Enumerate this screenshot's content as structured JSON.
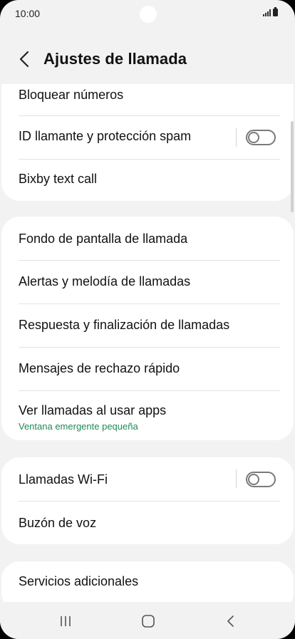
{
  "status": {
    "time": "10:00"
  },
  "header": {
    "title": "Ajustes de llamada"
  },
  "cards": {
    "block": {
      "blocked": "Bloquear números",
      "caller_id": "ID llamante y protección spam",
      "bixby": "Bixby text call"
    },
    "calls": {
      "wallpaper": "Fondo de pantalla de llamada",
      "alerts": "Alertas y melodía de llamadas",
      "answer": "Respuesta y finalización de llamadas",
      "reject": "Mensajes de rechazo rápido",
      "popup": "Ver llamadas al usar apps",
      "popup_sub": "Ventana emergente pequeña"
    },
    "network": {
      "wifi": "Llamadas Wi-Fi",
      "voicemail": "Buzón de voz"
    },
    "more": {
      "extra": "Servicios adicionales"
    }
  },
  "toggles": {
    "caller_id_on": false,
    "wifi_calling_on": false
  },
  "icons": {
    "back": "chevron-left-icon",
    "nav_recents": "recents-icon",
    "nav_home": "home-icon",
    "nav_back": "back-icon"
  },
  "colors": {
    "accent_sub": "#1f8a5a",
    "background": "#f2f2f2",
    "card": "#ffffff"
  }
}
